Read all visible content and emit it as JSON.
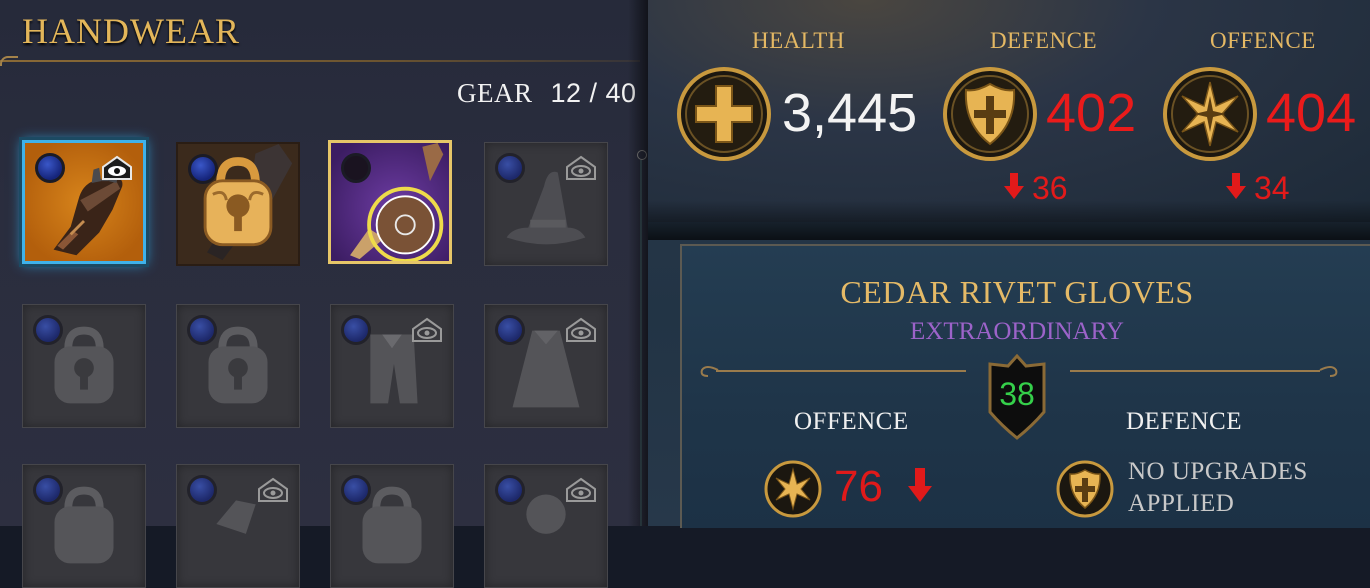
{
  "inventory": {
    "title": "HANDWEAR",
    "gear_label": "GEAR",
    "gear_count": "12 / 40",
    "slots": [
      {
        "state": "selected",
        "rarity": "superb",
        "item": "gloves",
        "new_icon": true
      },
      {
        "state": "locked",
        "rarity": "common",
        "item": "gloves"
      },
      {
        "state": "owned",
        "rarity": "extraordinary",
        "item": "gloves"
      },
      {
        "state": "empty",
        "item": "hat",
        "new_icon": true
      },
      {
        "state": "empty",
        "item": "lock"
      },
      {
        "state": "empty",
        "item": "lock"
      },
      {
        "state": "empty",
        "item": "outfit",
        "new_icon": true
      },
      {
        "state": "empty",
        "item": "cloak",
        "new_icon": true
      },
      {
        "state": "empty",
        "item": "lock"
      },
      {
        "state": "empty",
        "item": "gloves",
        "new_icon": true
      },
      {
        "state": "empty",
        "item": "lock"
      },
      {
        "state": "empty",
        "item": "face",
        "new_icon": true
      }
    ]
  },
  "stats": {
    "health": {
      "label": "HEALTH",
      "value": "3,445",
      "icon": "health-cross-icon"
    },
    "defence": {
      "label": "DEFENCE",
      "value": "402",
      "diff": "36",
      "icon": "shield-icon"
    },
    "offence": {
      "label": "OFFENCE",
      "value": "404",
      "diff": "34",
      "icon": "star-burst-icon"
    }
  },
  "item_card": {
    "name": "CEDAR RIVET GLOVES",
    "rarity": "EXTRAORDINARY",
    "level": "38",
    "offence_label": "OFFENCE",
    "offence_value": "76",
    "defence_label": "DEFENCE",
    "defence_text": "NO UPGRADES APPLIED"
  },
  "colors": {
    "gold": "#e4b864",
    "decrease_red": "#ea1b1b",
    "rarity_purple": "#9c63c9",
    "level_green": "#35d04a",
    "selection_blue": "#3fb2ea"
  }
}
